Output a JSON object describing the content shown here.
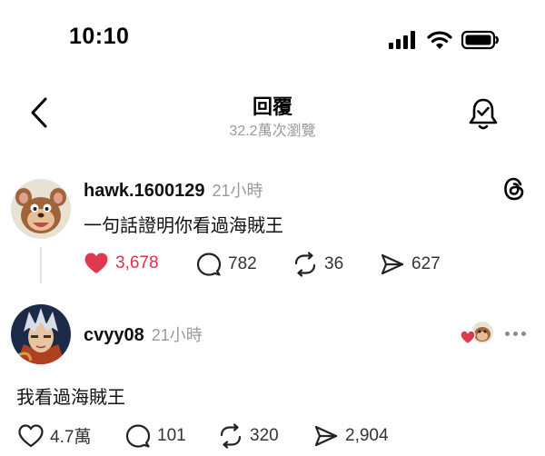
{
  "status_bar": {
    "time": "10:10"
  },
  "header": {
    "title": "回覆",
    "views": "32.2萬次瀏覽"
  },
  "post": {
    "username": "hawk.1600129",
    "time": "21小時",
    "text": "一句話證明你看過海賊王",
    "likes": "3,678",
    "comments": "782",
    "reposts": "36",
    "shares": "627"
  },
  "reply": {
    "username": "cvyy08",
    "time": "21小時",
    "text": "我看過海賊王",
    "likes": "4.7萬",
    "comments": "101",
    "reposts": "320",
    "shares": "2,904"
  },
  "colors": {
    "like_red": "#d7354b",
    "muted_gray": "#9a9a9a"
  }
}
